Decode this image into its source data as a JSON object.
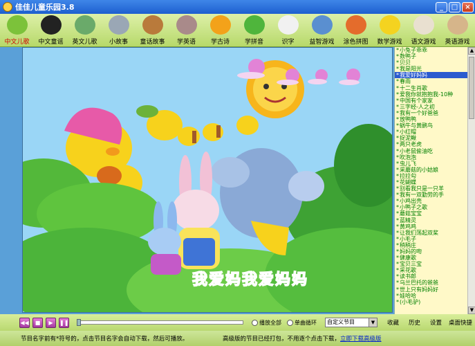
{
  "window": {
    "title": "佳佳儿童乐园3.8",
    "minimize_label": "_",
    "maximize_label": "□",
    "close_label": "×"
  },
  "toolbar": {
    "items": [
      {
        "label": "中文儿歌",
        "icon": "leaf-icon",
        "color": "#7cc23a",
        "active": true
      },
      {
        "label": "中文童谣",
        "icon": "panda-icon",
        "color": "#222222"
      },
      {
        "label": "英文儿歌",
        "icon": "turtle-icon",
        "color": "#6aaa6a"
      },
      {
        "label": "小故事",
        "icon": "elephant-icon",
        "color": "#9aa7b5"
      },
      {
        "label": "童话故事",
        "icon": "dog-icon",
        "color": "#b97a3b"
      },
      {
        "label": "学英语",
        "icon": "hippo-icon",
        "color": "#a98a8a"
      },
      {
        "label": "学古诗",
        "icon": "toucan-icon",
        "color": "#f3a21a"
      },
      {
        "label": "学拼音",
        "icon": "frog-icon",
        "color": "#4fb53c"
      },
      {
        "label": "识字",
        "icon": "rabbit-icon",
        "color": "#f1f1f1"
      },
      {
        "label": "益智游戏",
        "icon": "dolphin-icon",
        "color": "#5a8fd0"
      },
      {
        "label": "涂色拼图",
        "icon": "picture-frame-icon",
        "color": "#e46c2c"
      },
      {
        "label": "数学游戏",
        "icon": "chick-icon",
        "color": "#f4d320"
      },
      {
        "label": "语文游戏",
        "icon": "cat-icon",
        "color": "#e9e0d0"
      },
      {
        "label": "英语游戏",
        "icon": "puppy-icon",
        "color": "#d6b58a"
      }
    ]
  },
  "scene": {
    "caption": "我爱妈我爱妈妈"
  },
  "playlist": {
    "items": [
      "小兔子乖乖",
      "数鸭子",
      "贝贝",
      "我是阳光",
      "我爱好妈妈",
      "春雨",
      "十二生肖歌",
      "爱我你就抱抱我-10种",
      "中国有个家家",
      "三字经-人之初",
      "我有一个好爸爸",
      "放鸭鸭",
      "蜗牛与黄鹂鸟",
      "小红帽",
      "捉泥鳅",
      "两只老虎",
      "小老鼠偷油吃",
      "吹泡泡",
      "虫儿飞",
      "采蘑菇的小姑娘",
      "拉拉勾",
      "花蝴蝶",
      "别看我只是一只羊",
      "我有一双勤劳的手",
      "小鸡出壳",
      "小鸭子之歌",
      "蘑菇宝宝",
      "蓝精灵",
      "黄鸡鸡",
      "让我们荡起双桨",
      "小毛子",
      "稍稍庄",
      "妈妈的吻",
      "健康歌",
      "宝贝三宝",
      "采花歌",
      "读书郎",
      "乌兰巴托的爸爸",
      "世上只有妈妈好",
      "娃哈哈",
      "(小毛驴)"
    ],
    "selected_index": 4
  },
  "controls": {
    "buttons": [
      {
        "name": "prev-button",
        "glyph": "◀◀"
      },
      {
        "name": "stop-button",
        "glyph": "■"
      },
      {
        "name": "play-button",
        "glyph": "▶"
      },
      {
        "name": "pause-button",
        "glyph": "❚❚"
      }
    ],
    "play_all_label": "播放全部",
    "single_loop_label": "单曲循环",
    "playlist_select_value": "自定义节目",
    "favorites_label": "收藏",
    "history_label": "历史",
    "settings_label": "设置",
    "desktop_shortcut_label": "桌面快捷",
    "progress": 0.0
  },
  "status": {
    "left_text": "节目名字前有*符号的，点击节目名字会自动下载，然后可播放。",
    "right_text": "高级版的节目已经打包，不用逐个点击下载，",
    "download_link": "立即下载高级版"
  }
}
